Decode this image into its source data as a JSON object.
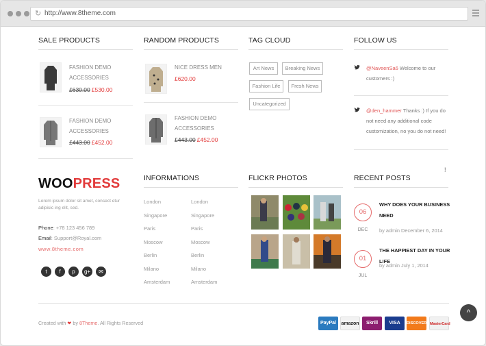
{
  "browser": {
    "url": "http://www.8theme.com"
  },
  "sale": {
    "title": "SALE PRODUCTS",
    "items": [
      {
        "name": "FASHION DEMO ACCESSORIES",
        "old": "£630.00",
        "new": "£530.00"
      },
      {
        "name": "FASHION DEMO ACCESSORIES",
        "old": "£443.00",
        "new": "£452.00"
      }
    ]
  },
  "random": {
    "title": "RANDOM PRODUCTS",
    "items": [
      {
        "name": "NICE DRESS MEN",
        "new": "£620.00"
      },
      {
        "name": "FASHION DEMO ACCESSORIES",
        "old": "£443.00",
        "new": "£452.00"
      }
    ]
  },
  "tags": {
    "title": "TAG CLOUD",
    "items": [
      "Art News",
      "Breaking News",
      "Fashion Life",
      "Fresh News",
      "Uncategorized"
    ]
  },
  "follow": {
    "title": "FOLLOW US",
    "tweets": [
      {
        "handle": "@NaveenSa6",
        "text": " Welcome to our customers :)"
      },
      {
        "handle": "@den_hammer",
        "text": " Thanks :) If you do not need any additional code customization, no you do not need!"
      }
    ]
  },
  "brand": {
    "logo_a": "WOO",
    "logo_b": "PRESS",
    "about": "Lorem ipsum dolor sit amet, consect etur adipisic ing elit, sed.",
    "phone_label": "Phone",
    "phone": ": +78 123 456 789",
    "email_label": "Email",
    "email": ": Support@Royal.com",
    "site": "www.8theme.com"
  },
  "social_icons": [
    "twitter-icon",
    "facebook-icon",
    "pinterest-icon",
    "google-plus-icon",
    "mail-icon"
  ],
  "informations": {
    "title": "INFORMATIONS",
    "col1": [
      "London",
      "Singapore",
      "Paris",
      "Moscow",
      "Berlin",
      "Milano",
      "Amsterdam"
    ],
    "col2": [
      "London",
      "Singapore",
      "Paris",
      "Moscow",
      "Berlin",
      "Milano",
      "Amsterdam"
    ]
  },
  "flickr": {
    "title": "FLICKR PHOTOS"
  },
  "posts": {
    "title": "RECENT POSTS",
    "items": [
      {
        "day": "06",
        "month": "DEC",
        "title": "WHY DOES YOUR BUSINESS NEED",
        "meta": "by admin December 6, 2014"
      },
      {
        "day": "01",
        "month": "JUL",
        "title": "THE HAPPIEST DAY IN YOUR LIFE",
        "meta": "by admin July 1, 2014"
      }
    ]
  },
  "footer": {
    "copy_a": "Created with",
    "copy_b": "by",
    "copy_brand": "8Theme",
    "copy_c": ". All Rights Reserved",
    "payments": [
      {
        "label": "PayPal",
        "color": "#2b7bbf"
      },
      {
        "label": "amazon",
        "color": "#f2f2f2"
      },
      {
        "label": "Skrill",
        "color": "#8c1e6f"
      },
      {
        "label": "VISA",
        "color": "#1a3c8e"
      },
      {
        "label": "DISCOVER",
        "color": "#f27a1a"
      },
      {
        "label": "MasterCard",
        "color": "#f1f1f1"
      }
    ]
  },
  "scroll_top_label": "^",
  "misc": {
    "bang": "!"
  }
}
